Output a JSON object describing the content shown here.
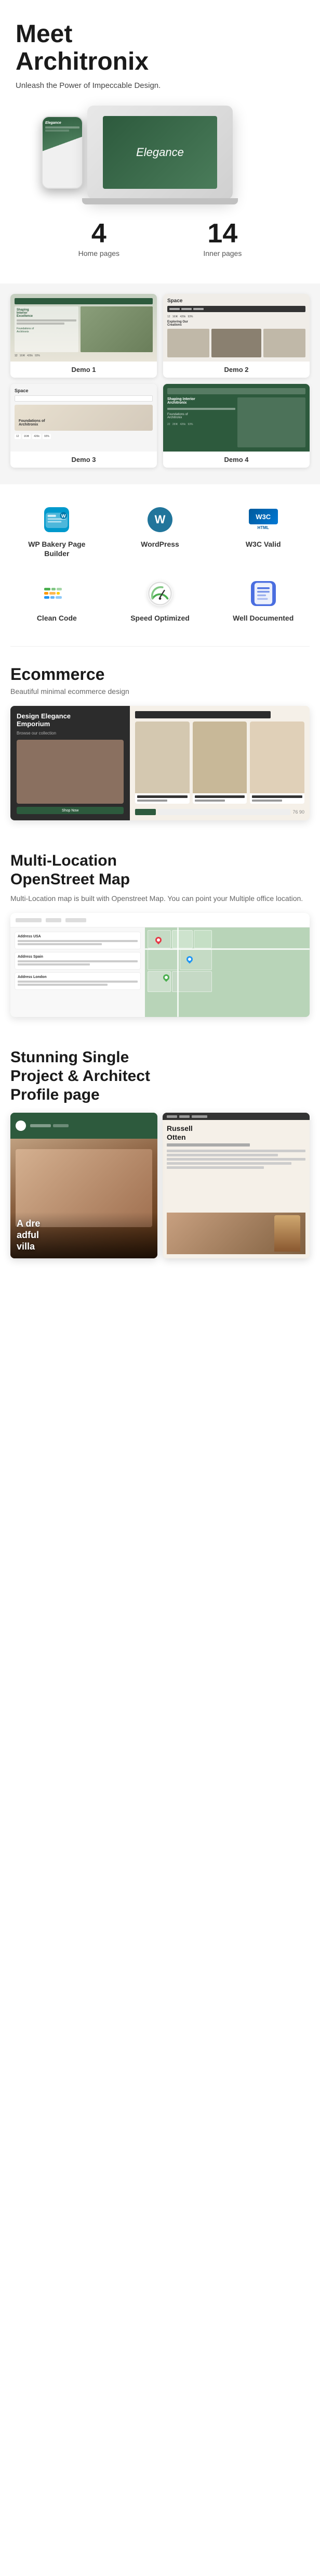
{
  "hero": {
    "title": "Meet\nArchitronix",
    "subtitle": "Unleash the Power of Impeccable Design.",
    "laptop_text": "Elegance",
    "stats": [
      {
        "number": "4",
        "label": "Home pages"
      },
      {
        "number": "14",
        "label": "Inner pages"
      }
    ]
  },
  "demos": [
    {
      "id": "demo1",
      "label": "Demo 1",
      "subtitle": "Shaping Interior Excellence",
      "sub2": "Foundations of Architronix"
    },
    {
      "id": "demo2",
      "label": "Demo 2",
      "subtitle": "Space",
      "sub2": "Exploring Our Creations"
    },
    {
      "id": "demo3",
      "label": "Demo 3",
      "subtitle": "Space",
      "sub2": "Foundations of Architronix"
    },
    {
      "id": "demo4",
      "label": "Demo 4",
      "subtitle": "Shaping Interior Architronix",
      "sub2": "Foundations of Architronix"
    }
  ],
  "features": [
    {
      "id": "wpbakery",
      "label": "WP Bakery\nPage Builder",
      "icon": "wpbakery"
    },
    {
      "id": "wordpress",
      "label": "WordPress",
      "icon": "wordpress"
    },
    {
      "id": "w3c",
      "label": "W3C Valid",
      "icon": "w3c"
    },
    {
      "id": "cleancode",
      "label": "Clean Code",
      "icon": "cleancode"
    },
    {
      "id": "speed",
      "label": "Speed\nOptimized",
      "icon": "speed"
    },
    {
      "id": "docs",
      "label": "Well\nDocumented",
      "icon": "docs"
    }
  ],
  "ecommerce": {
    "title": "Ecommerce",
    "subtitle": "Beautiful minimal ecommerce design",
    "product_title": "Design Elegance\nEmporium"
  },
  "map": {
    "title": "Multi-Location\nOpenStreet Map",
    "description": "Multi-Location map is built with Openstreet Map. You can point your Multiple office location.",
    "addresses": [
      {
        "label": "Address USA"
      },
      {
        "label": "Address Spain"
      },
      {
        "label": "Address London"
      }
    ]
  },
  "profile": {
    "title": "Stunning Single\nProject & Architect\nProfile page",
    "project_title": "A dre\nwful\nvilla",
    "architect_name": "Russell\nOtten"
  }
}
